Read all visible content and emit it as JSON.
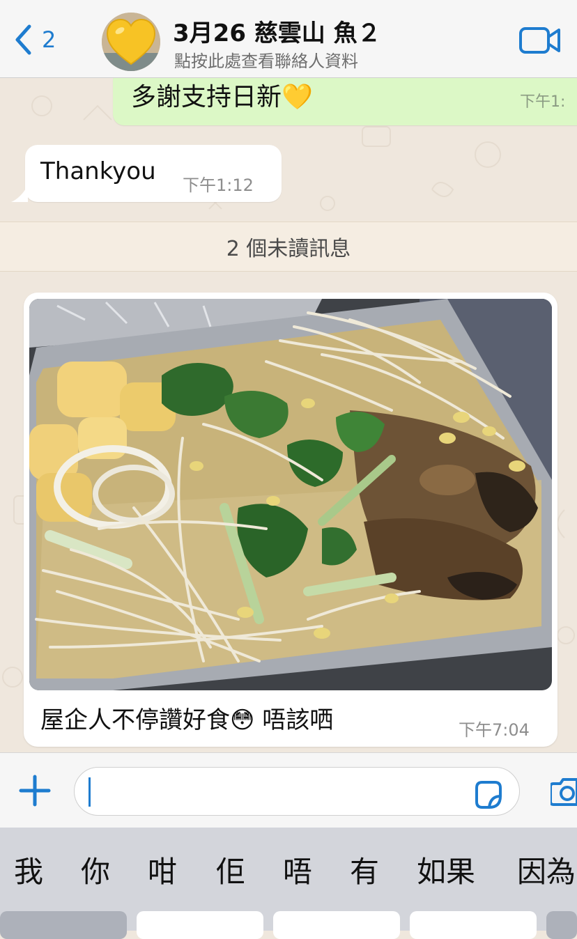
{
  "header": {
    "back_count": "2",
    "title": "3月26 慈雲山 魚２",
    "subtitle": "點按此處查看聯絡人資料",
    "back_icon": "chevron-left-icon",
    "video_icon": "video-camera-icon",
    "avatar_icon": "yellow-heart-emoji",
    "accent_color": "#1e7ccf"
  },
  "messages": {
    "outgoing": {
      "text": "多謝支持日新💛",
      "time": "下午1:"
    },
    "incoming": {
      "text": "Thankyou",
      "time": "下午1:12"
    },
    "unread_banner": "2 個未讀訊息",
    "photo_message": {
      "caption": "屋企人不停讚好食😳  唔該哂",
      "time": "下午7:04",
      "image_description_icon": "fish-dish-photo"
    }
  },
  "input_bar": {
    "value": "",
    "plus_icon": "plus-icon",
    "sticker_icon": "sticker-icon",
    "camera_icon": "camera-icon"
  },
  "keyboard": {
    "suggestions": [
      "我",
      "你",
      "咁",
      "佢",
      "唔",
      "有",
      "如果",
      "因為"
    ]
  }
}
